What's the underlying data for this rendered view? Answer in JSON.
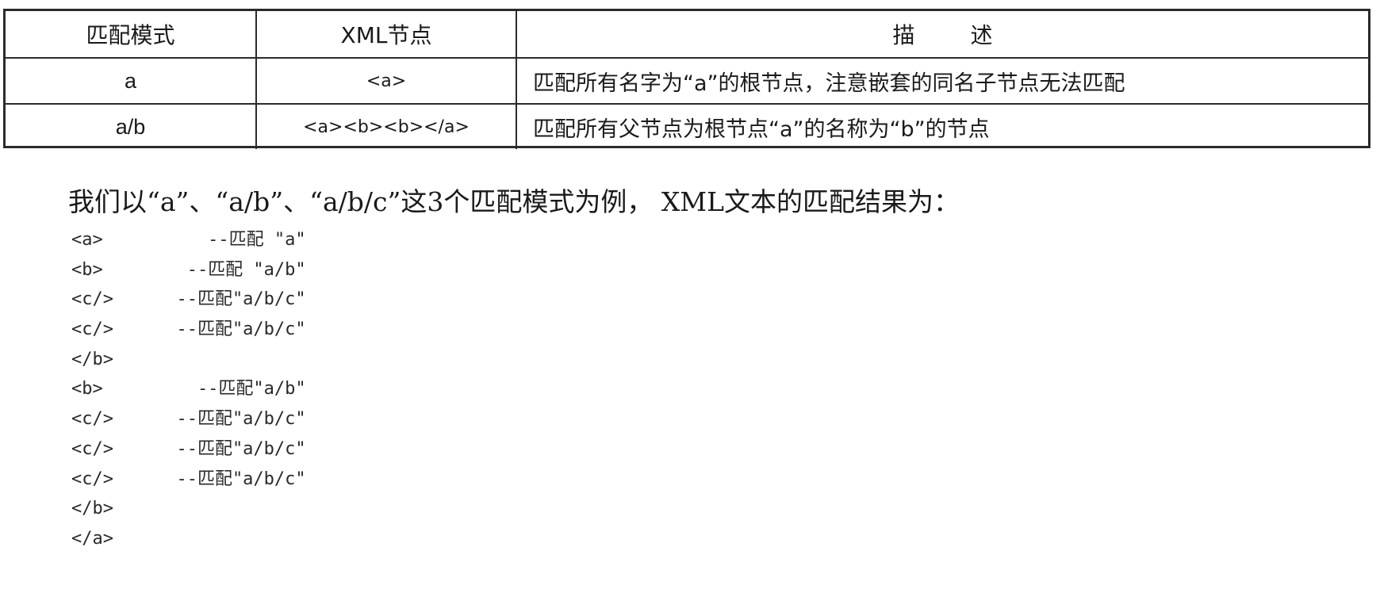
{
  "table": {
    "headers": [
      "匹配模式",
      "XML节点",
      "描",
      "述"
    ],
    "rows": [
      {
        "pattern": "a",
        "node": "<a>",
        "description": "匹配所有名字为“a”的根节点，注意嵌套的同名子节点无法匹配"
      },
      {
        "pattern": "a/b",
        "node": "<a><b><b></a>",
        "description": "匹配所有父节点为根节点“a”的名称为“b”的节点"
      }
    ]
  },
  "intro": "我们以“a”、“a/b”、“a/b/c”这3个匹配模式为例， XML文本的匹配结果为：",
  "code_lines": [
    "<a>          --匹配 \"a\"",
    "<b>        --匹配 \"a/b\"",
    "<c/>      --匹配\"a/b/c\"",
    "<c/>      --匹配\"a/b/c\"",
    "</b>",
    "<b>         --匹配\"a/b\"",
    "<c/>      --匹配\"a/b/c\"",
    "<c/>      --匹配\"a/b/c\"",
    "<c/>      --匹配\"a/b/c\"",
    "</b>",
    "</a>"
  ]
}
